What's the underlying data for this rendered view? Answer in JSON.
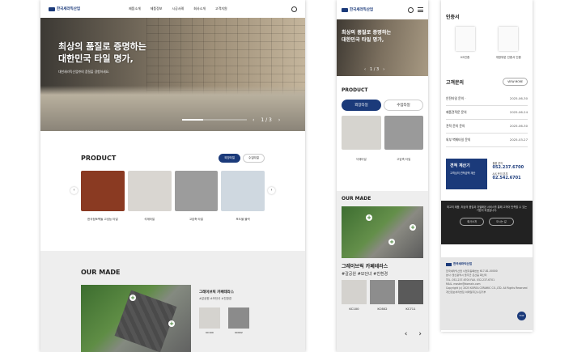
{
  "brand": {
    "name": "한국세라믹산업"
  },
  "desktop": {
    "nav": [
      "제품소개",
      "제품정보",
      "시공사례",
      "회사소개",
      "고객지원"
    ],
    "hero": {
      "title_line1": "최상의 품질로 증명하는",
      "title_line2": "대한민국 타일 명가,",
      "subtitle": "대한세라믹산업㈜의 품질을 경험하세요.",
      "pager": "1 / 3",
      "progress": 0.33
    },
    "product": {
      "title": "PRODUCT",
      "tabs": [
        "외장타일",
        "수입타일"
      ],
      "items": [
        {
          "label": "한국점토벽돌 고성능 타일",
          "color": "#8a3a22"
        },
        {
          "label": "석재타일",
          "color": "#d9d6d1"
        },
        {
          "label": "고압축 타일",
          "color": "#9c9c9c"
        },
        {
          "label": "포도블 블럭",
          "color": "#cfd8e0"
        }
      ]
    },
    "ourmade": {
      "title": "OUR MADE",
      "item_title": "그레이브릭 카페테라스",
      "tags": "#갈공원 #모던녀 #친환경",
      "swatches": [
        {
          "label": "KC100",
          "color": "#d5d3cf"
        },
        {
          "label": "KC602",
          "color": "#8b8b8b"
        }
      ]
    }
  },
  "mobile": {
    "hero": {
      "title_line1": "최상의 품질로 증명하는",
      "title_line2": "대한민국 타일 명가,",
      "pager": "1 / 3"
    },
    "product": {
      "title": "PRODUCT",
      "tabs": [
        "외장타일",
        "수입타일"
      ],
      "items": [
        {
          "label": "석재타일",
          "color": "#d6d4cf"
        },
        {
          "label": "고압축 타일",
          "color": "#9a9a9a"
        }
      ]
    },
    "ourmade": {
      "title": "OUR MADE",
      "item_title": "그레이브릭 카페테라스",
      "tags": "#갈공원 #모던녀 #친환경",
      "swatches": [
        {
          "label": "KC100",
          "color": "#d4d2ce"
        },
        {
          "label": "KC602",
          "color": "#8d8d8d"
        },
        {
          "label": "KC711",
          "color": "#5a5a5a"
        }
      ]
    }
  },
  "side": {
    "certs_title": "인증서",
    "certs": [
      "KS인증",
      "개방부분 인증서 인증"
    ],
    "inquiry_title": "고객문의",
    "inquiry_more": "VIEW MORE",
    "inquiries": [
      {
        "title": "안전타일 문의 ·",
        "date": "2025-06-30"
      },
      {
        "title": "제품견적문 문의",
        "date": "2025-06-24"
      },
      {
        "title": "견적 문의 문의",
        "date": "2025-06-30"
      },
      {
        "title": "외부 벽체타일 문의",
        "date": "2025-03-27"
      }
    ],
    "card1": {
      "title": "견적 계산기",
      "desc": "고객님의 견적금액 계산"
    },
    "card2": {
      "label1": "물품 문의",
      "phone1": "052.237.6700",
      "label2": "A/S 문의 본부",
      "phone2": "02.542.6701"
    },
    "notice": {
      "text": "최고의 제품, 최상의 품질과 차별화된 서비스를 통해 고객이 만족할 수 있는 기업이 되겠습니다.",
      "btn1": "회사소개",
      "btn2": "오시는 길"
    },
    "footer": {
      "logo": "한국세라믹산업",
      "lines": [
        "한국세라믹산업 사업자등록번호 617-81-00000",
        "본사: 울산광역시 울주군 온산읍 화산리",
        "TEL. 052-237-6700  FAX. 052-237-6701",
        "MAIL. master@domain.com",
        "Copyright (c) 2025 KOREA CERAMIC CO.,LTD. All Rights Reserved",
        "개인정보처리방침  이메일무단수집거부"
      ],
      "top": "TOP"
    }
  }
}
